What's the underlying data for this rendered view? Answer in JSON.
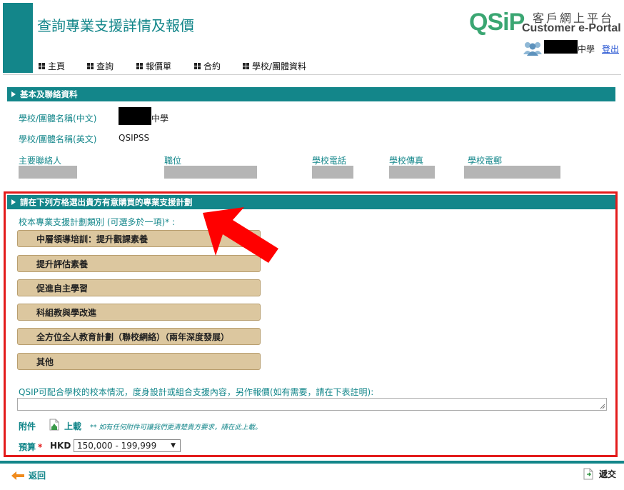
{
  "header": {
    "title": "查詢專業支援詳情及報價",
    "logo_text": "QSiP",
    "portal_zh": "客戶網上平台",
    "portal_en": "Customer e-Portal",
    "user_suffix": "中學",
    "logout": "登出"
  },
  "nav": [
    {
      "label": "主頁",
      "icon": "grid-icon"
    },
    {
      "label": "查詢",
      "icon": "grid-icon"
    },
    {
      "label": "報價單",
      "icon": "grid-icon"
    },
    {
      "label": "合約",
      "icon": "grid-icon"
    },
    {
      "label": "學校/團體資料",
      "icon": "grid-icon"
    }
  ],
  "basic": {
    "section_title": "基本及聯絡資料",
    "name_zh_label": "學校/團體名稱(中文)",
    "name_zh_suffix": "中學",
    "name_en_label": "學校/團體名稱(英文)",
    "name_en_value": "QSIPSS",
    "contact_label": "主要聯絡人",
    "position_label": "職位",
    "phone_label": "學校電話",
    "fax_label": "學校傳真",
    "email_label": "學校電郵"
  },
  "plan": {
    "section_title": "請在下列方格選出貴方有意購買的專業支援計劃",
    "category_label": "校本專業支援計劃類別 (可選多於一項)* :",
    "categories": [
      "中層領導培訓：提升觀課素養",
      "提升評估素養",
      "促進自主學習",
      "科組教與學改進",
      "全方位全人教育計劃（聯校網絡）（兩年深度發展）",
      "其他"
    ],
    "custom_note": "QSIP可配合學校的校本情況，度身設計或組合支援內容，另作報價(如有需要，請在下表註明):",
    "attachment_label": "附件",
    "upload_label": "上載",
    "upload_note": "** 如有任何附件可讓我們更清楚貴方要求，請在此上載。",
    "budget_label": "預算",
    "budget_required": "*",
    "currency": "HKD",
    "budget_value": "150,000 - 199,999"
  },
  "footer": {
    "back": "返回",
    "submit": "遞交"
  },
  "colors": {
    "teal": "#13868a",
    "highlight_red": "#e31b1b",
    "button_tan": "#dcc79f"
  }
}
